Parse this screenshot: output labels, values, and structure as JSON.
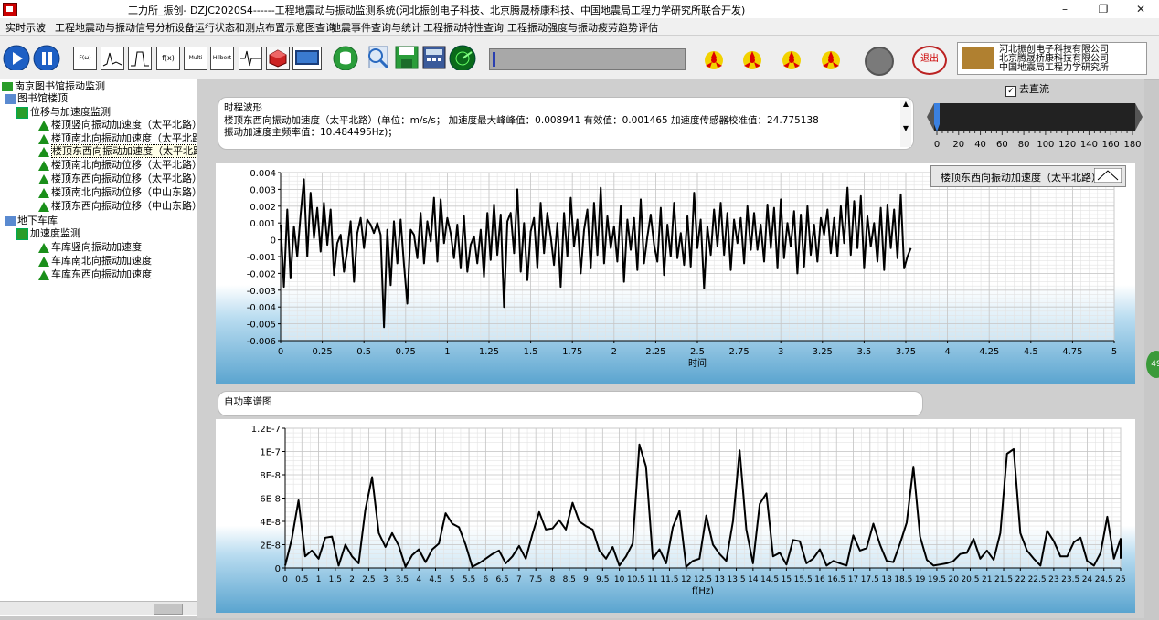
{
  "window": {
    "title": "工力所_振创- DZJC2020S4------工程地震动与振动监测系统(河北振创电子科技、北京腾晟桥康科技、中国地震局工程力学研究所联合开发)",
    "min_label": "–",
    "max_label": "❐",
    "close_label": "✕"
  },
  "menu": [
    "实时示波",
    "工程地震动与振动信号分析",
    "设备运行状态和测点布置示意图查询",
    "地震事件查询与统计",
    "工程振动特性查询",
    "工程振动强度与振动疲劳趋势评估"
  ],
  "toolbar": {
    "icons": [
      "play-icon",
      "pause-icon",
      "fft-icon",
      "spectrum-icon",
      "filter-icon",
      "function-icon",
      "wavelet-icon",
      "hilbert-icon",
      "waveform-icon",
      "cube-icon",
      "monitor-icon",
      "database-icon",
      "search-icon",
      "save-icon",
      "calculator-icon",
      "radar-icon",
      "hazard-icon",
      "exit-icon"
    ],
    "sq_labels": [
      "F(ω)",
      "",
      "",
      "f(x)",
      "Multi Analysis",
      "Hilbert"
    ],
    "exit_label": "退出",
    "progress": 0.015
  },
  "logo": {
    "lines": [
      "河北振创电子科技有限公司",
      "北京腾晟桥康科技有限公司",
      "中国地震局工程力学研究所"
    ]
  },
  "tree": {
    "root": "南京图书馆振动监测",
    "nodes": [
      {
        "label": "图书馆楼顶",
        "depth": 1
      },
      {
        "label": "位移与加速度监测",
        "depth": 2
      },
      {
        "label": "楼顶竖向振动加速度（太平北路）",
        "depth": 3
      },
      {
        "label": "楼顶南北向振动加速度（太平北路",
        "depth": 3
      },
      {
        "label": "楼顶东西向振动加速度（太平北路）",
        "depth": 3,
        "selected": true
      },
      {
        "label": "楼顶南北向振动位移（太平北路）",
        "depth": 3
      },
      {
        "label": "楼顶东西向振动位移（太平北路）",
        "depth": 3
      },
      {
        "label": "楼顶南北向振动位移（中山东路）",
        "depth": 3
      },
      {
        "label": "楼顶东西向振动位移（中山东路）",
        "depth": 3
      },
      {
        "label": "地下车库",
        "depth": 1
      },
      {
        "label": "加速度监测",
        "depth": 2
      },
      {
        "label": "车库竖向振动加速度",
        "depth": 3
      },
      {
        "label": "车库南北向振动加速度",
        "depth": 3
      },
      {
        "label": "车库东西向振动加速度",
        "depth": 3
      }
    ]
  },
  "waveform_info": {
    "label": "时程波形",
    "line1": "楼顶东西向振动加速度（太平北路）(单位：m/s/s；  加速度最大峰峰值：0.008941  有效值：0.001465  加速度传感器校准值：24.775138",
    "line2": "振动加速度主频率值：10.484495Hz)；"
  },
  "detrend": {
    "label": "去直流",
    "checked": true
  },
  "slider": {
    "ticks": [
      "0",
      "20",
      "40",
      "60",
      "80",
      "100",
      "120",
      "140",
      "160",
      "180"
    ],
    "value": 0
  },
  "spectrum_info": {
    "label": "自功率谱图"
  },
  "side_badge": "49",
  "legend": {
    "label": "楼顶东西向振动加速度（太平北路）"
  },
  "chart_data": [
    {
      "type": "line",
      "xlabel": "时间",
      "ylabel": "",
      "xlim": [
        0,
        5
      ],
      "ylim": [
        -0.006,
        0.004
      ],
      "x_ticks": [
        "0",
        "0.25",
        "0.5",
        "0.75",
        "1",
        "1.25",
        "1.5",
        "1.75",
        "2",
        "2.25",
        "2.5",
        "2.75",
        "3",
        "3.25",
        "3.5",
        "3.75",
        "4",
        "4.25",
        "4.5",
        "4.75",
        "5"
      ],
      "y_ticks": [
        "0.004",
        "0.003",
        "0.002",
        "0.001",
        "0",
        "-0.001",
        "-0.002",
        "-0.003",
        "-0.004",
        "-0.005",
        "-0.006"
      ],
      "series": [
        {
          "name": "楼顶东西向振动加速度（太平北路）",
          "x_start": 0.0,
          "dx": 0.02,
          "values": [
            0.0009,
            -0.0028,
            0.0018,
            -0.0023,
            0.0008,
            -0.001,
            0.0015,
            0.0036,
            -0.001,
            0.0028,
            0.0001,
            0.0019,
            -0.0007,
            0.0022,
            -0.0003,
            0.0018,
            -0.0021,
            -0.0002,
            0.0003,
            -0.0019,
            -0.0006,
            0.0011,
            -0.0025,
            0.0004,
            0.0013,
            -0.0005,
            0.0012,
            0.0009,
            0.0004,
            0.001,
            0.0003,
            -0.0052,
            0.0006,
            -0.0027,
            0.0011,
            -0.0014,
            0.0012,
            -0.0015,
            -0.0038,
            0.0006,
            0.0003,
            -0.0011,
            0.0016,
            -0.0014,
            0.0011,
            -0.0001,
            0.0025,
            -0.0013,
            0.0024,
            -0.0002,
            0.0013,
            0.0004,
            -0.0011,
            0.0009,
            -0.0017,
            0.0014,
            -0.0019,
            -0.0003,
            0.0002,
            -0.0014,
            0.0006,
            -0.0022,
            0.0016,
            -0.0012,
            0.0021,
            -0.0009,
            0.0015,
            -0.004,
            0.0011,
            0.0016,
            -0.0008,
            0.003,
            -0.0019,
            0.001,
            -0.0024,
            0.0005,
            0.0013,
            -0.0017,
            0.0022,
            -0.0008,
            0.0016,
            0.0002,
            -0.0015,
            0.001,
            -0.0028,
            0.0016,
            -0.001,
            0.0025,
            -0.0004,
            0.0012,
            -0.002,
            0.0006,
            0.0018,
            -0.0017,
            0.0022,
            -0.0009,
            0.0031,
            -0.0014,
            0.0014,
            -0.0005,
            0.0008,
            -0.0013,
            0.002,
            -0.0025,
            0.0012,
            -0.0006,
            0.0013,
            -0.0018,
            0.0024,
            -0.0014,
            0.0002,
            0.0015,
            -0.0003,
            -0.0013,
            0.0019,
            -0.0021,
            0.0009,
            -0.001,
            0.0022,
            -0.0011,
            0.0004,
            -0.0015,
            0.0014,
            -0.0016,
            0.0028,
            -0.0005,
            0.0012,
            -0.0029,
            0.0008,
            -0.0009,
            0.0018,
            -0.0004,
            0.0022,
            -0.0009,
            0.0016,
            -0.0018,
            0.0012,
            -0.0002,
            0.0013,
            -0.0014,
            0.002,
            -0.0006,
            0.0016,
            -0.0006,
            0.0009,
            -0.0013,
            0.0021,
            -0.0005,
            0.0019,
            -0.0017,
            0.0024,
            -0.0011,
            0.001,
            -0.0004,
            0.0017,
            -0.002,
            0.0015,
            -0.0016,
            0.002,
            -0.0009,
            0.0009,
            -0.0013,
            0.0013,
            0.0003,
            0.0018,
            -0.0008,
            0.0013,
            -0.001,
            0.002,
            -0.0002,
            0.0031,
            -0.0009,
            0.0023,
            -0.0005,
            0.0026,
            -0.0017,
            0.0014,
            -0.0004,
            0.001,
            -0.0013,
            0.0019,
            -0.0018,
            0.0021,
            -0.0005,
            0.0018,
            -0.0011,
            0.0027,
            -0.0017,
            -0.001,
            -0.0005
          ]
        }
      ]
    },
    {
      "type": "line",
      "xlabel": "f(Hz)",
      "ylabel": "",
      "xlim": [
        0,
        25
      ],
      "ylim": [
        0,
        1.2e-07
      ],
      "x_ticks": [
        "0",
        "0.5",
        "1",
        "1.5",
        "2",
        "2.5",
        "3",
        "3.5",
        "4",
        "4.5",
        "5",
        "5.5",
        "6",
        "6.5",
        "7",
        "7.5",
        "8",
        "8.5",
        "9",
        "9.5",
        "10",
        "10.5",
        "11",
        "11.5",
        "12",
        "12.5",
        "13",
        "13.5",
        "14",
        "14.5",
        "15",
        "15.5",
        "16",
        "16.5",
        "17",
        "17.5",
        "18",
        "18.5",
        "19",
        "19.5",
        "20",
        "20.5",
        "21",
        "21.5",
        "22",
        "22.5",
        "23",
        "23.5",
        "24",
        "24.5",
        "25"
      ],
      "y_ticks": [
        "1.2E-7",
        "1E-7",
        "8E-8",
        "6E-8",
        "4E-8",
        "2E-8",
        "0"
      ],
      "series": [
        {
          "name": "自功率谱",
          "x_start": 0.0,
          "dx": 0.2,
          "values": [
            2e-09,
            2.5e-08,
            5.8e-08,
            1e-08,
            1.5e-08,
            8e-09,
            2.6e-08,
            2.7e-08,
            2e-09,
            2e-08,
            1e-08,
            4e-09,
            5e-08,
            7.8e-08,
            3e-08,
            1.8e-08,
            3e-08,
            1.9e-08,
            1e-09,
            1.1e-08,
            1.6e-08,
            5e-09,
            1.6e-08,
            2.1e-08,
            4.7e-08,
            3.8e-08,
            3.5e-08,
            2e-08,
            1e-09,
            4e-09,
            8e-09,
            1.2e-08,
            1.5e-08,
            4e-09,
            1e-08,
            1.9e-08,
            8e-09,
            2.9e-08,
            4.8e-08,
            3.3e-08,
            3.4e-08,
            4.1e-08,
            3.3e-08,
            5.6e-08,
            4e-08,
            3.6e-08,
            3.3e-08,
            1.5e-08,
            8e-09,
            1.8e-08,
            2e-09,
            1e-08,
            2.1e-08,
            1.06e-07,
            8.7e-08,
            8e-09,
            1.6e-08,
            4e-09,
            3.5e-08,
            4.9e-08,
            1e-09,
            6e-09,
            8e-09,
            4.5e-08,
            2e-08,
            1.2e-08,
            6e-09,
            4e-08,
            1.01e-07,
            3.3e-08,
            4e-09,
            5.5e-08,
            6.4e-08,
            1e-08,
            1.3e-08,
            3e-09,
            2.4e-08,
            2.3e-08,
            4e-09,
            8e-09,
            1.6e-08,
            2e-09,
            6e-09,
            4e-09,
            2e-09,
            2.8e-08,
            1.5e-08,
            1.7e-08,
            3.8e-08,
            2e-08,
            6e-09,
            5e-09,
            2.1e-08,
            3.9e-08,
            8.7e-08,
            2.7e-08,
            7e-09,
            2e-09,
            3e-09,
            4e-09,
            6e-09,
            1.2e-08,
            1.3e-08,
            2.5e-08,
            8e-09,
            1.5e-08,
            7e-09,
            3e-08,
            9.8e-08,
            1.02e-07,
            3e-08,
            1.5e-08,
            8e-09,
            2e-09,
            3.2e-08,
            2.3e-08,
            1e-08,
            1e-08,
            2.2e-08,
            2.6e-08,
            6e-09,
            2e-09,
            1.3e-08,
            4.4e-08,
            8e-09,
            2.5e-08,
            8e-09
          ]
        }
      ]
    }
  ]
}
